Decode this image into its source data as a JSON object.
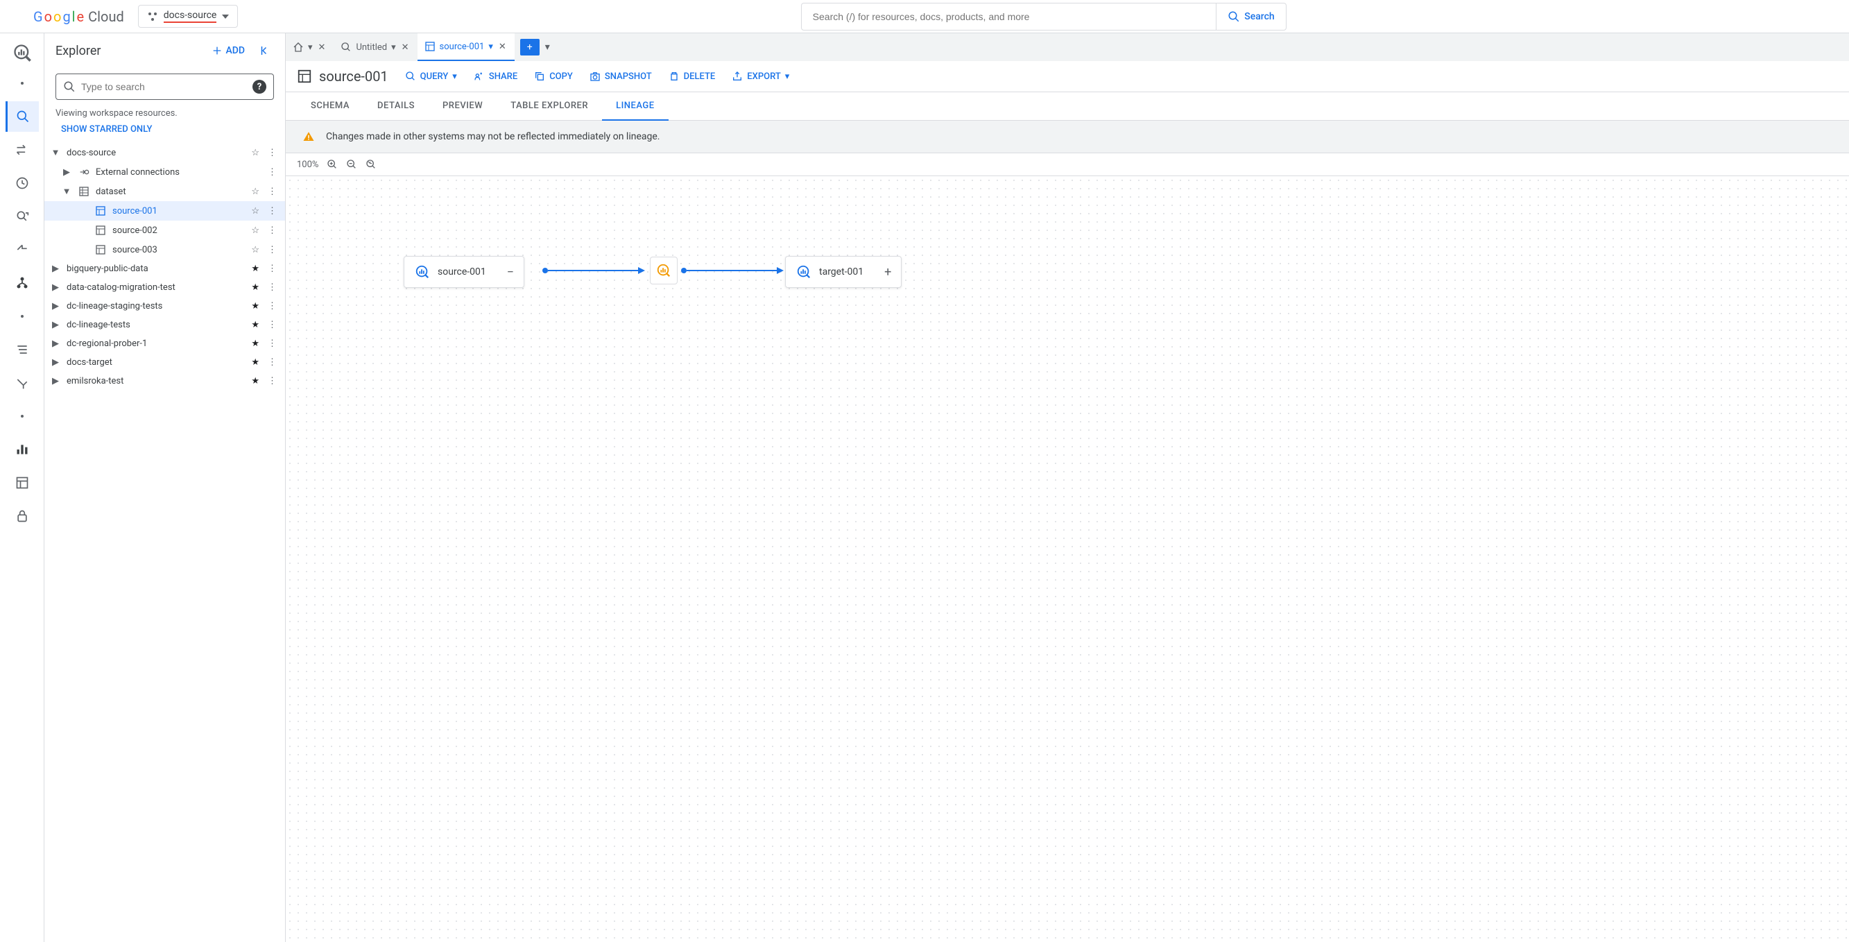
{
  "header": {
    "logo_text": "Cloud",
    "project_name": "docs-source",
    "search_placeholder": "Search (/) for resources, docs, products, and more",
    "search_button": "Search"
  },
  "explorer": {
    "title": "Explorer",
    "add_button": "ADD",
    "search_placeholder": "Type to search",
    "viewing_text": "Viewing workspace resources.",
    "show_starred": "SHOW STARRED ONLY",
    "tree": {
      "project": "docs-source",
      "external": "External connections",
      "dataset": "dataset",
      "tables": [
        "source-001",
        "source-002",
        "source-003"
      ],
      "other_projects": [
        "bigquery-public-data",
        "data-catalog-migration-test",
        "dc-lineage-staging-tests",
        "dc-lineage-tests",
        "dc-regional-prober-1",
        "docs-target",
        "emilsroka-test"
      ]
    }
  },
  "tabs": {
    "untitled": "Untitled",
    "active": "source-001"
  },
  "content": {
    "title": "source-001",
    "actions": {
      "query": "QUERY",
      "share": "SHARE",
      "copy": "COPY",
      "snapshot": "SNAPSHOT",
      "delete": "DELETE",
      "export": "EXPORT"
    },
    "subtabs": [
      "SCHEMA",
      "DETAILS",
      "PREVIEW",
      "TABLE EXPLORER",
      "LINEAGE"
    ],
    "warning": "Changes made in other systems may not be reflected immediately on lineage.",
    "zoom": "100%",
    "lineage": {
      "source": "source-001",
      "target": "target-001"
    }
  }
}
